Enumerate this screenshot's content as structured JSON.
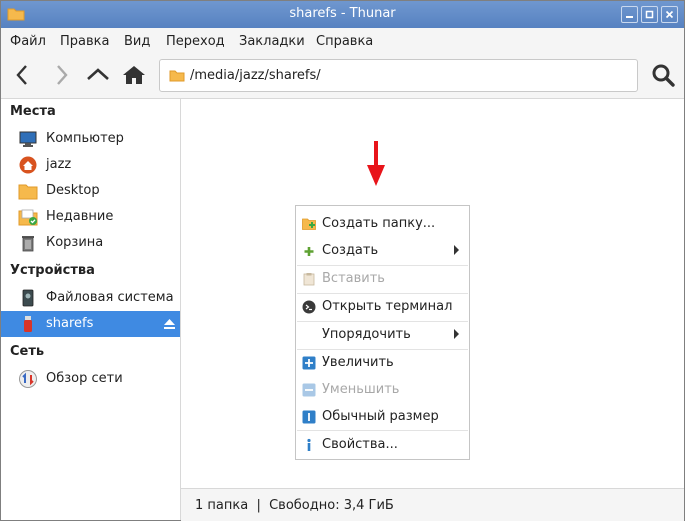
{
  "window": {
    "title": "sharefs - Thunar"
  },
  "menubar": [
    "Файл",
    "Правка",
    "Вид",
    "Переход",
    "Закладки",
    "Справка"
  ],
  "toolbar": {
    "path": "/media/jazz/sharefs/"
  },
  "sidebar": {
    "places_header": "Места",
    "places": [
      {
        "label": "Компьютер",
        "icon": "computer-icon"
      },
      {
        "label": "jazz",
        "icon": "home-icon"
      },
      {
        "label": "Desktop",
        "icon": "folder-icon"
      },
      {
        "label": "Недавние",
        "icon": "recent-icon"
      },
      {
        "label": "Корзина",
        "icon": "trash-icon"
      }
    ],
    "devices_header": "Устройства",
    "devices": [
      {
        "label": "Файловая система",
        "icon": "drive-icon"
      },
      {
        "label": "sharefs",
        "icon": "usb-drive-icon",
        "selected": true
      }
    ],
    "network_header": "Сеть",
    "network": [
      {
        "label": "Обзор сети",
        "icon": "network-icon"
      }
    ]
  },
  "context_menu": [
    {
      "label": "Создать папку...",
      "icon": "new-folder-icon",
      "disabled": false
    },
    {
      "label": "Создать",
      "icon": "plus-icon",
      "disabled": false,
      "submenu": true
    },
    {
      "label": "Вставить",
      "icon": "paste-icon",
      "disabled": true
    },
    {
      "label": "Открыть терминал",
      "icon": "terminal-icon",
      "disabled": false
    },
    {
      "label": "Упорядочить",
      "icon": "",
      "disabled": false,
      "submenu": true
    },
    {
      "label": "Увеличить",
      "icon": "zoom-in-icon",
      "disabled": false
    },
    {
      "label": "Уменьшить",
      "icon": "zoom-out-icon",
      "disabled": true
    },
    {
      "label": "Обычный размер",
      "icon": "zoom-normal-icon",
      "disabled": false
    },
    {
      "label": "Свойства...",
      "icon": "info-icon",
      "disabled": false
    }
  ],
  "status": "1 папка  |  Свободно: 3,4 ГиБ",
  "colors": {
    "titlebar": "#6a92cc",
    "selection": "#3f8ae2",
    "annotation_arrow": "#e8141a"
  }
}
